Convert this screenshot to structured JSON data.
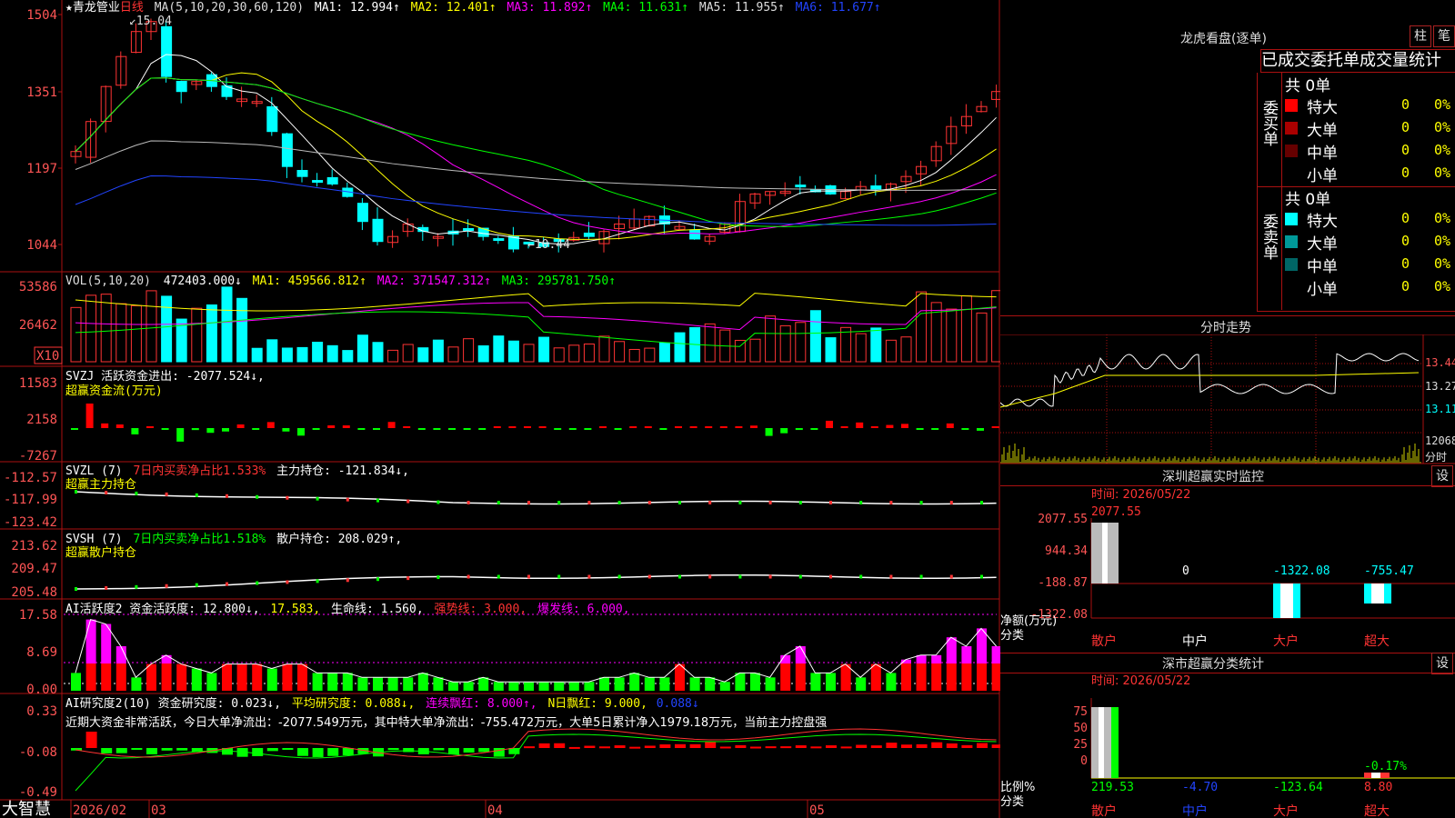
{
  "stock": {
    "name": "青龙管业",
    "period": "日线",
    "ma_params": "MA(5,10,20,30,60,120)",
    "ma_values": [
      {
        "label": "MA1: 12.994↑",
        "color": "#ffffff"
      },
      {
        "label": "MA2: 12.401↑",
        "color": "#ffff00"
      },
      {
        "label": "MA3: 11.892↑",
        "color": "#ff00ff"
      },
      {
        "label": "MA4: 11.631↑",
        "color": "#00ff00"
      },
      {
        "label": "MA5: 11.955↑",
        "color": "#dddddd"
      },
      {
        "label": "MA6: 11.677↑",
        "color": "#2244ff"
      }
    ],
    "high_label": "15.04",
    "low_label": "10.44"
  },
  "price_axis": [
    "1504",
    "1351",
    "1197",
    "1044"
  ],
  "date_axis": [
    "2026/02",
    "03",
    "04",
    "05"
  ],
  "vol": {
    "label": "VOL(5,10,20)",
    "value": "472403.000↓",
    "ma1": "MA1: 459566.812↑",
    "ma2": "MA2: 371547.312↑",
    "ma3": "MA3: 295781.750↑",
    "axis": [
      "53586",
      "26462"
    ],
    "unit": "X10"
  },
  "svzj": {
    "label": "SVZJ  活跃资金进出: -2077.524↓,",
    "sub": "超赢资金流(万元)",
    "axis": [
      "11583",
      "2158",
      "-7267"
    ]
  },
  "svzl": {
    "label": "SVZL (7)",
    "pct": "7日内买卖净占比1.533%",
    "hold": "主力持仓: -121.834↓,",
    "sub": "超赢主力持仓",
    "axis": [
      "-112.57",
      "-117.99",
      "-123.42"
    ]
  },
  "svsh": {
    "label": "SVSH (7)",
    "pct": "7日内买卖净占比1.518%",
    "hold": "散户持仓: 208.029↑,",
    "sub": "超赢散户持仓",
    "axis": [
      "213.62",
      "209.47",
      "205.48"
    ]
  },
  "ai_active": {
    "label": "AI活跃度2 资金活跃度: 12.800↓,",
    "v2": "17.583,",
    "life": "生命线: 1.560,",
    "strong": "强势线: 3.000,",
    "burst": "爆发线: 6.000,",
    "axis": [
      "17.58",
      "8.69",
      "0.00"
    ]
  },
  "ai_research": {
    "label": "AI研究度2(10) 资金研究度: 0.023↓,",
    "avg": "平均研究度: 0.088↓,",
    "cont": "连续飘红: 8.000↑,",
    "n": "N日飘红: 9.000,",
    "last": "0.088↓",
    "axis": [
      "0.33",
      "-0.08",
      "-0.49"
    ],
    "summary": "近期大资金非常活跃，今日大单净流出：-2077.549万元，其中特大单净流出：-755.472万元，大单5日累计净入1979.18万元，当前主力控盘强"
  },
  "brand": "大智慧",
  "right": {
    "lhb_title": "龙虎看盘(逐单)",
    "btn_col": "柱",
    "btn_pen": "笔",
    "tabs": "已成交委托单成交量统计",
    "buy_label": "委买单",
    "sell_label": "委卖单",
    "buy_total": "共 0单",
    "sell_total": "共 0单",
    "buy_rows": [
      {
        "name": "特大",
        "v": "0",
        "p": "0%",
        "color": "#ff0000"
      },
      {
        "name": "大单",
        "v": "0",
        "p": "0%",
        "color": "#aa0000"
      },
      {
        "name": "中单",
        "v": "0",
        "p": "0%",
        "color": "#660000"
      },
      {
        "name": "小单",
        "v": "0",
        "p": "0%",
        "color": ""
      }
    ],
    "sell_rows": [
      {
        "name": "特大",
        "v": "0",
        "p": "0%",
        "color": "#00ffff"
      },
      {
        "name": "大单",
        "v": "0",
        "p": "0%",
        "color": "#009999"
      },
      {
        "name": "中单",
        "v": "0",
        "p": "0%",
        "color": "#006666"
      },
      {
        "name": "小单",
        "v": "0",
        "p": "0%",
        "color": ""
      }
    ],
    "intraday_title": "分时走势",
    "intraday_axis": [
      "13.44",
      "13.27",
      "13.11",
      "12068",
      "分时"
    ],
    "sz_title": "深圳超赢实时监控",
    "sz_btn": "设",
    "sz_time": "时间: 2026/05/22",
    "sz_axis": [
      "2077.55",
      "944.34",
      "-188.87",
      "-1322.08"
    ],
    "sz_values": [
      "2077.55",
      "0",
      "-1322.08",
      "-755.47"
    ],
    "sz_ylabel": "净额(万元)",
    "sz_xlabel": "分类",
    "cats": [
      "散户",
      "中户",
      "大户",
      "超大"
    ],
    "cls_title": "深市超赢分类统计",
    "cls_btn": "设",
    "cls_time": "时间: 2026/05/22",
    "cls_axis": [
      "75",
      "50",
      "25",
      "0"
    ],
    "cls_values": [
      "219.53",
      "-4.70",
      "-123.64",
      "8.80"
    ],
    "cls_pct": "-0.17%",
    "cls_ylabel": "比例%",
    "cls_xlabel": "分类"
  },
  "colors": {
    "up": "#ff3333",
    "down": "#00ffff",
    "border": "#aa1111",
    "axis_text": "#ff5555"
  }
}
